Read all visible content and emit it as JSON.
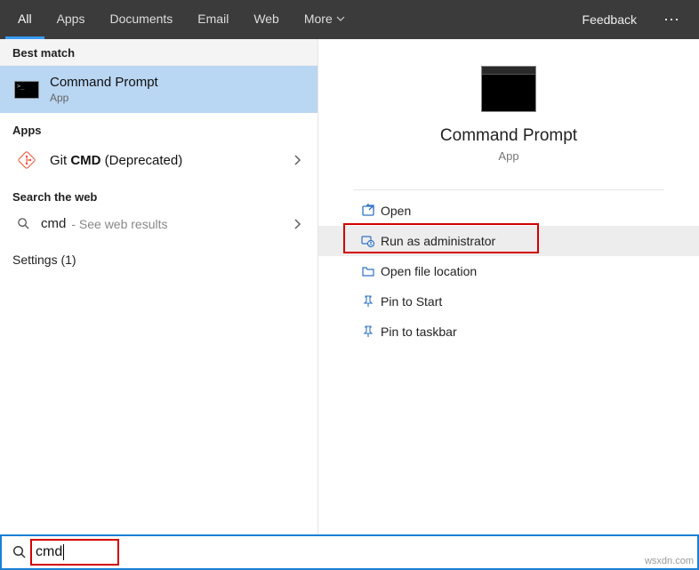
{
  "tabs": {
    "items": [
      {
        "label": "All",
        "active": true
      },
      {
        "label": "Apps",
        "active": false
      },
      {
        "label": "Documents",
        "active": false
      },
      {
        "label": "Email",
        "active": false
      },
      {
        "label": "Web",
        "active": false
      },
      {
        "label": "More",
        "active": false,
        "dropdown": true
      }
    ],
    "feedback": "Feedback",
    "more_icon": "⋯"
  },
  "left": {
    "best_match_header": "Best match",
    "best_match": {
      "title": "Command Prompt",
      "sub": "App"
    },
    "apps_header": "Apps",
    "apps_item": {
      "prefix": "Git ",
      "bold": "CMD",
      "suffix": " (Deprecated)"
    },
    "web_header": "Search the web",
    "web_item": {
      "query": "cmd",
      "hint": " - See web results"
    },
    "settings": "Settings (1)"
  },
  "detail": {
    "title": "Command Prompt",
    "sub": "App",
    "actions": {
      "open": "Open",
      "run_admin": "Run as administrator",
      "open_loc": "Open file location",
      "pin_start": "Pin to Start",
      "pin_taskbar": "Pin to taskbar"
    }
  },
  "search": {
    "query": "cmd"
  },
  "watermark": "wsxdn.com"
}
